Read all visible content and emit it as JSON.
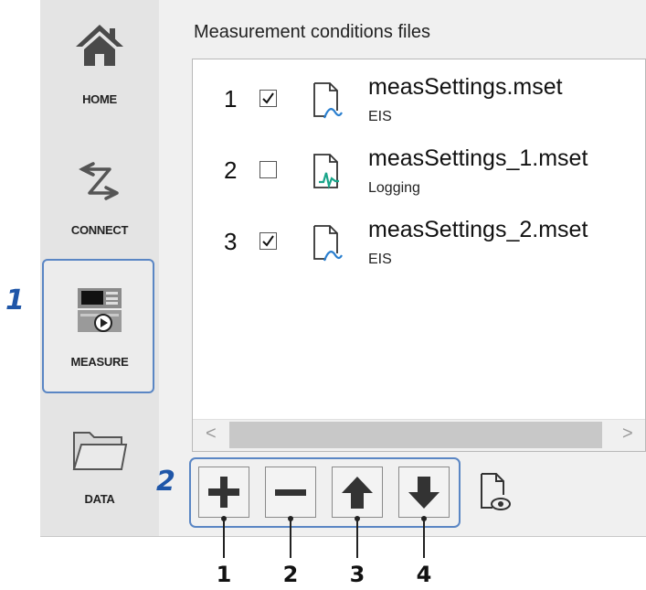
{
  "callouts": {
    "one": "1",
    "two": "2"
  },
  "nav": {
    "home": "HOME",
    "connect": "CONNECT",
    "measure": "MEASURE",
    "data": "DATA"
  },
  "panel": {
    "title": "Measurement conditions files"
  },
  "files": [
    {
      "index": "1",
      "checked": true,
      "name": "measSettings.mset",
      "type": "EIS",
      "icon": "eis-file-icon"
    },
    {
      "index": "2",
      "checked": false,
      "name": "measSettings_1.mset",
      "type": "Logging",
      "icon": "logging-file-icon"
    },
    {
      "index": "3",
      "checked": true,
      "name": "measSettings_2.mset",
      "type": "EIS",
      "icon": "eis-file-icon"
    }
  ],
  "scrollbar": {
    "left_arrow": "<",
    "right_arrow": ">"
  },
  "toolbar": {
    "buttons": [
      "add-icon",
      "remove-icon",
      "move-up-icon",
      "move-down-icon",
      "preview-file-icon"
    ],
    "labels": [
      "1",
      "2",
      "3",
      "4"
    ]
  },
  "colors": {
    "accent_blue": "#1f56a8",
    "highlight_border": "#5a86c4",
    "eis_icon": "#2a7fcf",
    "logging_icon": "#1aa58a"
  }
}
